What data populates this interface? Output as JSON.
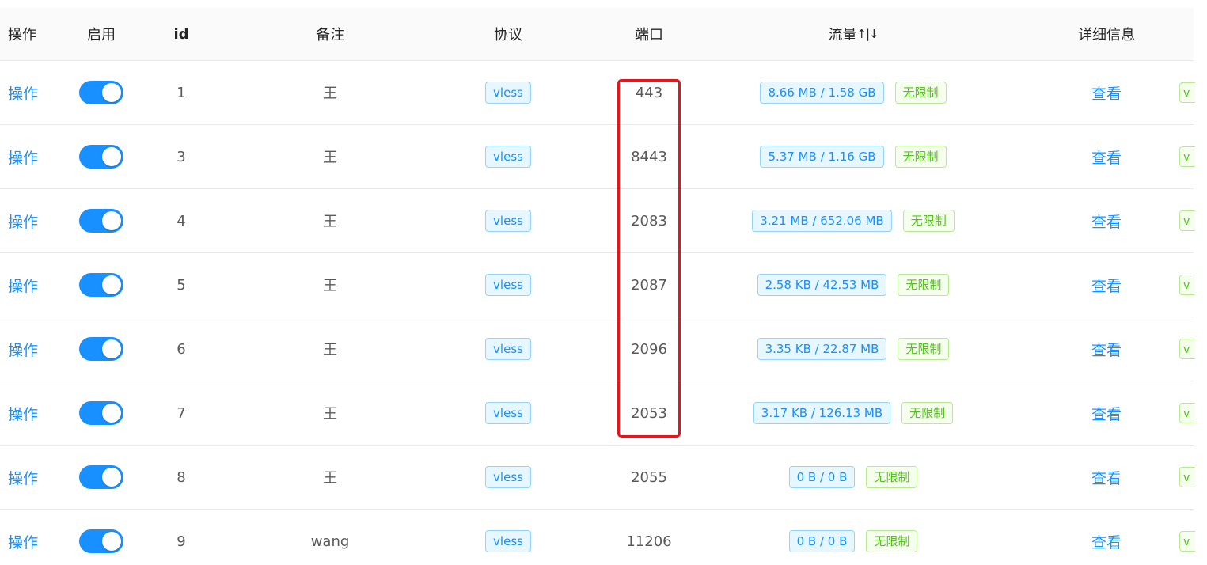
{
  "header": {
    "op": "操作",
    "enable": "启用",
    "id": "id",
    "remark": "备注",
    "protocol": "协议",
    "port": "端口",
    "traffic": "流量",
    "traffic_sort": "↑|↓",
    "detail": "详细信息"
  },
  "rows": [
    {
      "op": "操作",
      "enabled": true,
      "id": "1",
      "remark": "王",
      "protocol": "vless",
      "port": "443",
      "traffic": "8.66 MB / 1.58 GB",
      "limit": "无限制",
      "detail": "查看",
      "extra": "v"
    },
    {
      "op": "操作",
      "enabled": true,
      "id": "3",
      "remark": "王",
      "protocol": "vless",
      "port": "8443",
      "traffic": "5.37 MB / 1.16 GB",
      "limit": "无限制",
      "detail": "查看",
      "extra": "v"
    },
    {
      "op": "操作",
      "enabled": true,
      "id": "4",
      "remark": "王",
      "protocol": "vless",
      "port": "2083",
      "traffic": "3.21 MB / 652.06 MB",
      "limit": "无限制",
      "detail": "查看",
      "extra": "v"
    },
    {
      "op": "操作",
      "enabled": true,
      "id": "5",
      "remark": "王",
      "protocol": "vless",
      "port": "2087",
      "traffic": "2.58 KB / 42.53 MB",
      "limit": "无限制",
      "detail": "查看",
      "extra": "v"
    },
    {
      "op": "操作",
      "enabled": true,
      "id": "6",
      "remark": "王",
      "protocol": "vless",
      "port": "2096",
      "traffic": "3.35 KB / 22.87 MB",
      "limit": "无限制",
      "detail": "查看",
      "extra": "v"
    },
    {
      "op": "操作",
      "enabled": true,
      "id": "7",
      "remark": "王",
      "protocol": "vless",
      "port": "2053",
      "traffic": "3.17 KB / 126.13 MB",
      "limit": "无限制",
      "detail": "查看",
      "extra": "v"
    },
    {
      "op": "操作",
      "enabled": true,
      "id": "8",
      "remark": "王",
      "protocol": "vless",
      "port": "2055",
      "traffic": "0 B / 0 B",
      "limit": "无限制",
      "detail": "查看",
      "extra": "v"
    },
    {
      "op": "操作",
      "enabled": true,
      "id": "9",
      "remark": "wang",
      "protocol": "vless",
      "port": "11206",
      "traffic": "0 B / 0 B",
      "limit": "无限制",
      "detail": "查看",
      "extra": "v"
    }
  ],
  "colors": {
    "link": "#1890ff",
    "switch_on": "#1890ff",
    "tag_blue": "#1890ff",
    "tag_green": "#52c41a",
    "highlight": "#e8141a"
  }
}
